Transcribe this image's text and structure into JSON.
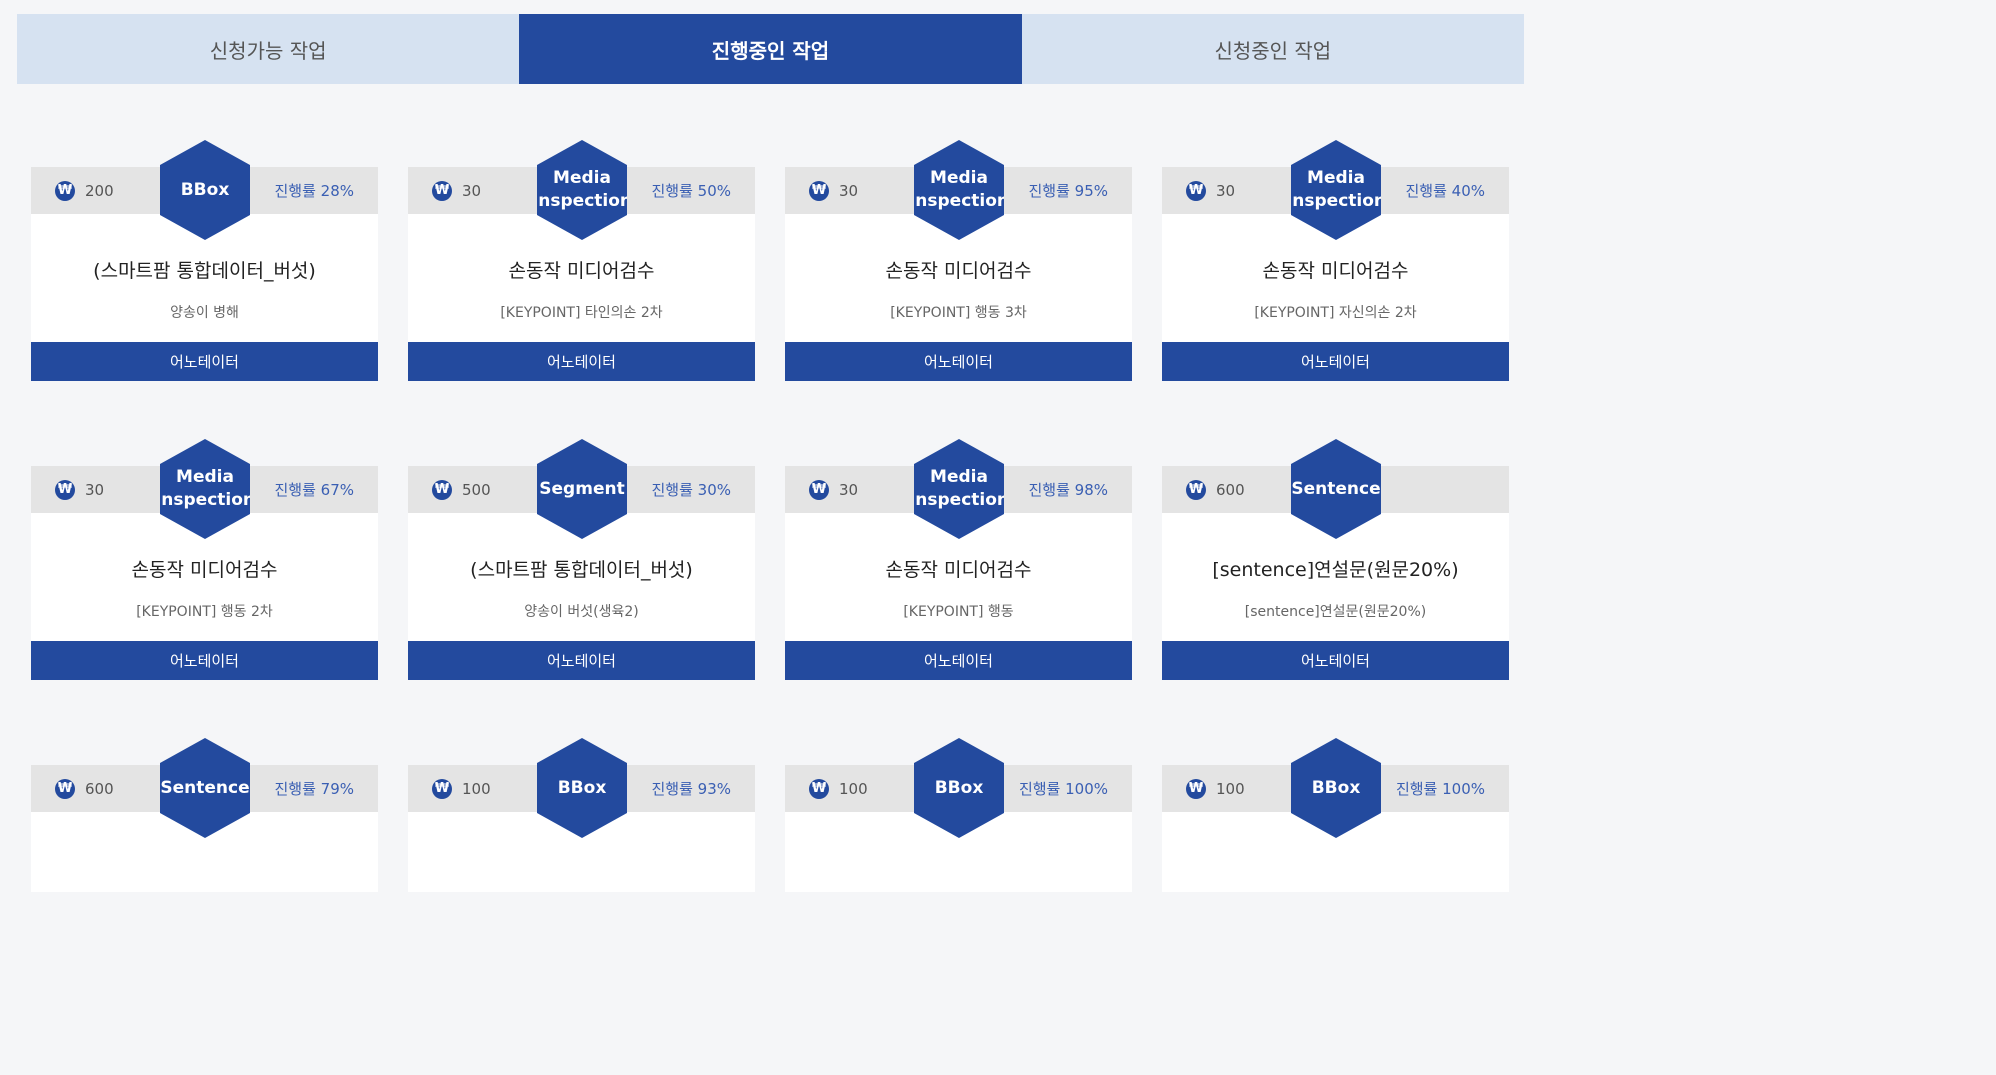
{
  "tabs": [
    {
      "label": "신청가능 작업",
      "active": false
    },
    {
      "label": "진행중인 작업",
      "active": true
    },
    {
      "label": "신청중인 작업",
      "active": false
    }
  ],
  "currency_symbol": "₩",
  "colors": {
    "primary": "#234a9e",
    "tab_inactive": "#d6e2f1",
    "strip": "#e4e4e4",
    "progress_text": "#3a5fb3"
  },
  "cards": [
    {
      "price": "200",
      "type": "BBox",
      "progress": "진행률 28%",
      "title": "(스마트팜 통합데이터_버섯)",
      "subtitle": "양송이 병해",
      "button": "어노테이터"
    },
    {
      "price": "30",
      "type": "Media Inspection",
      "progress": "진행률 50%",
      "title": "손동작 미디어검수",
      "subtitle": "[KEYPOINT] 타인의손 2차",
      "button": "어노테이터"
    },
    {
      "price": "30",
      "type": "Media Inspection",
      "progress": "진행률 95%",
      "title": "손동작 미디어검수",
      "subtitle": "[KEYPOINT] 행동 3차",
      "button": "어노테이터"
    },
    {
      "price": "30",
      "type": "Media Inspection",
      "progress": "진행률 40%",
      "title": "손동작 미디어검수",
      "subtitle": "[KEYPOINT] 자신의손 2차",
      "button": "어노테이터"
    },
    {
      "price": "30",
      "type": "Media Inspection",
      "progress": "진행률 67%",
      "title": "손동작 미디어검수",
      "subtitle": "[KEYPOINT] 행동 2차",
      "button": "어노테이터"
    },
    {
      "price": "500",
      "type": "Segment",
      "progress": "진행률 30%",
      "title": "(스마트팜 통합데이터_버섯)",
      "subtitle": "양송이 버섯(생육2)",
      "button": "어노테이터"
    },
    {
      "price": "30",
      "type": "Media Inspection",
      "progress": "진행률 98%",
      "title": "손동작 미디어검수",
      "subtitle": "[KEYPOINT] 행동",
      "button": "어노테이터"
    },
    {
      "price": "600",
      "type": "Sentence",
      "progress": "",
      "title": "[sentence]연설문(원문20%)",
      "subtitle": "[sentence]연설문(원문20%)",
      "button": "어노테이터"
    },
    {
      "price": "600",
      "type": "Sentence",
      "progress": "진행률 79%",
      "title": "",
      "subtitle": "",
      "button": ""
    },
    {
      "price": "100",
      "type": "BBox",
      "progress": "진행률 93%",
      "title": "",
      "subtitle": "",
      "button": ""
    },
    {
      "price": "100",
      "type": "BBox",
      "progress": "진행률 100%",
      "title": "",
      "subtitle": "",
      "button": ""
    },
    {
      "price": "100",
      "type": "BBox",
      "progress": "진행률 100%",
      "title": "",
      "subtitle": "",
      "button": ""
    }
  ]
}
